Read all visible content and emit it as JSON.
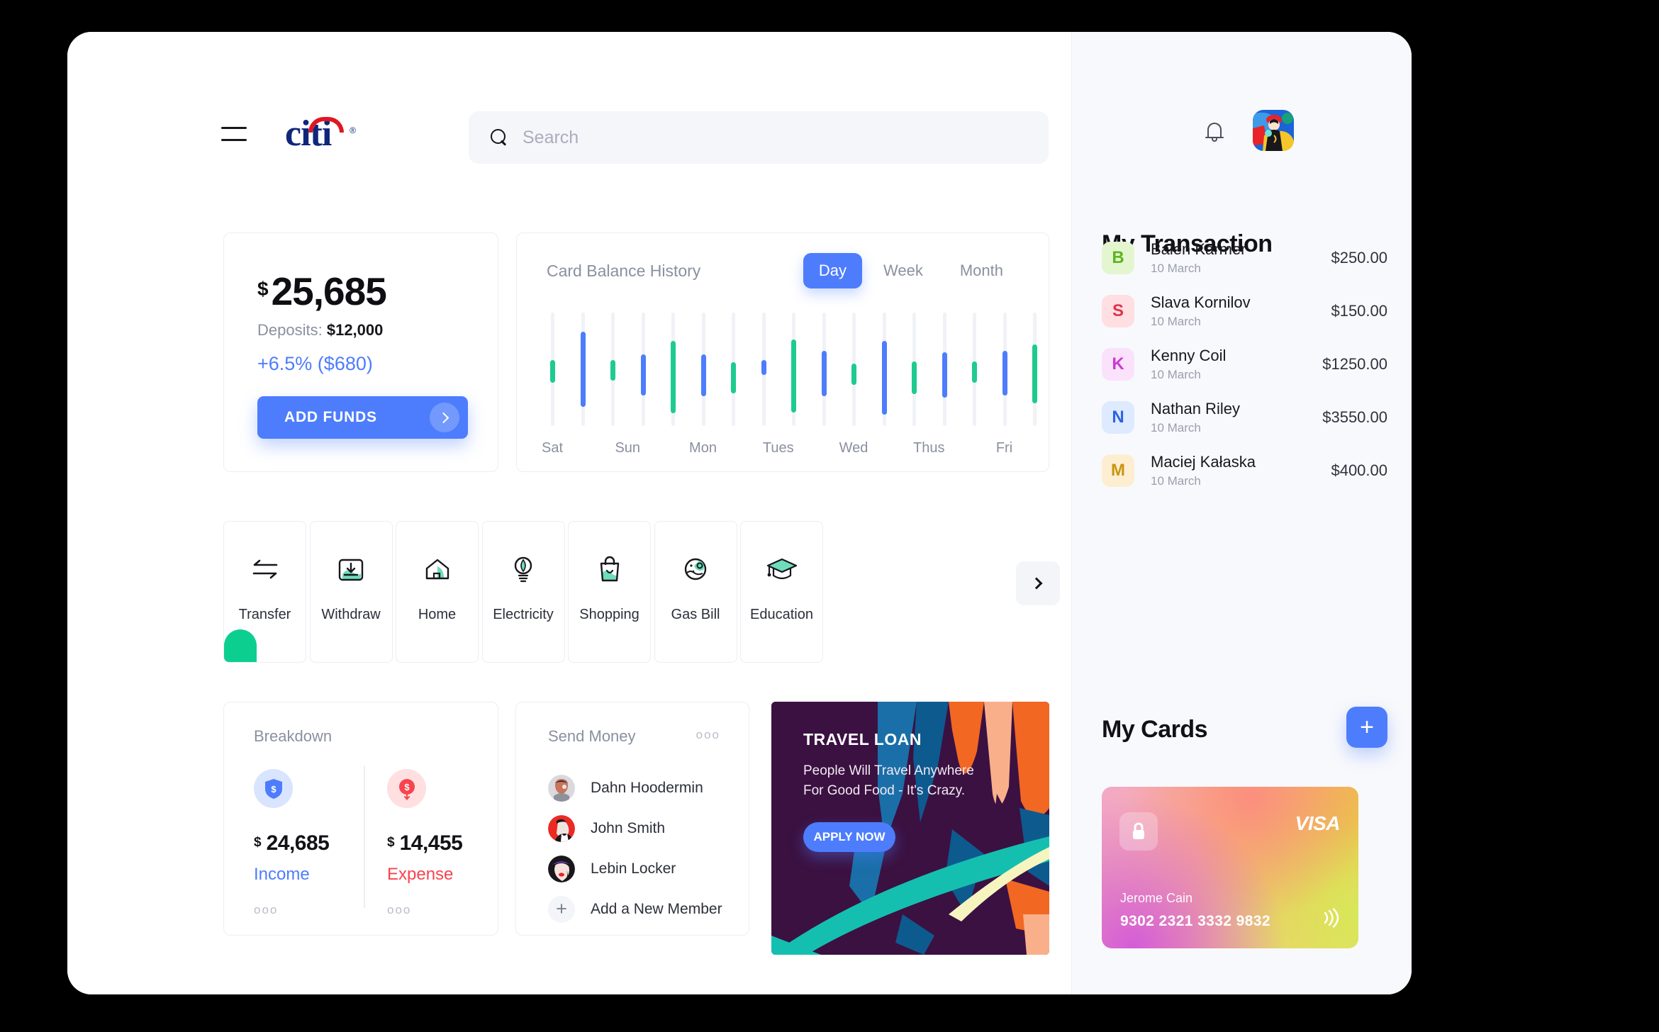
{
  "header": {
    "logo_text": "citi",
    "menu_icon": "hamburger-icon",
    "search_placeholder": "Search",
    "search_value": "",
    "bell_icon": "notification-bell-icon"
  },
  "balance": {
    "currency": "$",
    "amount": "25,685",
    "deposits_label": "Deposits:",
    "deposits_value": "$12,000",
    "change": "+6.5% ($680)",
    "cta": "ADD FUNDS"
  },
  "chart_card": {
    "title": "Card Balance History",
    "ranges": [
      {
        "label": "Day",
        "active": true
      },
      {
        "label": "Week",
        "active": false
      },
      {
        "label": "Month",
        "active": false
      }
    ]
  },
  "chart_data": {
    "type": "bar",
    "title": "Card Balance History",
    "subtitle": "Day",
    "xlabel": "",
    "ylabel": "",
    "grid": false,
    "legend": false,
    "axis_range": [
      0,
      100
    ],
    "categories": [
      "Sat",
      "Sun",
      "Mon",
      "Tues",
      "Wed",
      "Thus",
      "Fri"
    ],
    "note": "Floating range bars: each bar has a low and high value on a 0-100 track; color encodes direction.",
    "bars": [
      {
        "index": 0,
        "low": 38,
        "high": 58,
        "color": "green"
      },
      {
        "index": 1,
        "low": 17,
        "high": 83,
        "color": "blue"
      },
      {
        "index": 2,
        "low": 40,
        "high": 58,
        "color": "green"
      },
      {
        "index": 3,
        "low": 27,
        "high": 63,
        "color": "blue"
      },
      {
        "index": 4,
        "low": 11,
        "high": 75,
        "color": "green"
      },
      {
        "index": 5,
        "low": 26,
        "high": 63,
        "color": "blue"
      },
      {
        "index": 6,
        "low": 29,
        "high": 56,
        "color": "green"
      },
      {
        "index": 7,
        "low": 45,
        "high": 58,
        "color": "blue"
      },
      {
        "index": 8,
        "low": 12,
        "high": 76,
        "color": "green"
      },
      {
        "index": 9,
        "low": 26,
        "high": 66,
        "color": "blue"
      },
      {
        "index": 10,
        "low": 36,
        "high": 55,
        "color": "green"
      },
      {
        "index": 11,
        "low": 10,
        "high": 75,
        "color": "blue"
      },
      {
        "index": 12,
        "low": 28,
        "high": 57,
        "color": "green"
      },
      {
        "index": 13,
        "low": 25,
        "high": 65,
        "color": "blue"
      },
      {
        "index": 14,
        "low": 38,
        "high": 57,
        "color": "green"
      },
      {
        "index": 15,
        "low": 27,
        "high": 66,
        "color": "blue"
      },
      {
        "index": 16,
        "low": 20,
        "high": 72,
        "color": "green"
      }
    ],
    "colors": {
      "green": "#1ecb8f",
      "blue": "#4d7dfd",
      "track": "#f1f2f7"
    }
  },
  "quick_actions": [
    {
      "label": "Transfer",
      "icon": "transfer-arrows-icon"
    },
    {
      "label": "Withdraw",
      "icon": "withdraw-download-icon"
    },
    {
      "label": "Home",
      "icon": "home-icon"
    },
    {
      "label": "Electricity",
      "icon": "lightbulb-icon"
    },
    {
      "label": "Shopping",
      "icon": "shopping-bag-icon"
    },
    {
      "label": "Gas Bill",
      "icon": "fuel-drop-icon"
    },
    {
      "label": "Education",
      "icon": "graduation-cap-icon"
    }
  ],
  "quick_actions_next": "next-arrow-icon",
  "breakdown": {
    "title": "Breakdown",
    "items": [
      {
        "icon": "shield-dollar-icon",
        "currency": "$",
        "value": "24,685",
        "label": "Income",
        "color": "#4d7dfd",
        "bg": "#d9e5ff"
      },
      {
        "icon": "expense-dollar-icon",
        "currency": "$",
        "value": "14,455",
        "label": "Expense",
        "color": "#f7444e",
        "bg": "#ffdfe0"
      }
    ],
    "more": "ooo"
  },
  "send_money": {
    "title": "Send Money",
    "more": "ooo",
    "members": [
      {
        "name": "Dahn Hoodermin",
        "avatar": "avatar-dahn"
      },
      {
        "name": "John Smith",
        "avatar": "avatar-john"
      },
      {
        "name": "Lebin Locker",
        "avatar": "avatar-lebin"
      }
    ],
    "add_label": "Add a New Member"
  },
  "promo": {
    "title": "TRAVEL LOAN",
    "subtitle": "People Will Travel Anywhere\nFor Good Food - It's Crazy.",
    "cta": "APPLY NOW"
  },
  "transactions": {
    "title": "My Transaction",
    "items": [
      {
        "initial": "B",
        "name": "Balen Karmer",
        "date": "10 March",
        "amount": "$250.00",
        "bg": "#e4f6cf",
        "fg": "#5cb522"
      },
      {
        "initial": "S",
        "name": "Slava Kornilov",
        "date": "10 March",
        "amount": "$150.00",
        "bg": "#ffdfe1",
        "fg": "#e0334a"
      },
      {
        "initial": "K",
        "name": "Kenny Coil",
        "date": "10 March",
        "amount": "$1250.00",
        "bg": "#fbe2fb",
        "fg": "#cc3ad0"
      },
      {
        "initial": "N",
        "name": "Nathan Riley",
        "date": "10 March",
        "amount": "$3550.00",
        "bg": "#ddeaff",
        "fg": "#2b63e0"
      },
      {
        "initial": "M",
        "name": "Maciej Kałaska",
        "date": "10 March",
        "amount": "$400.00",
        "bg": "#fdeed2",
        "fg": "#c99512"
      }
    ]
  },
  "cards_section": {
    "title": "My Cards",
    "add_label": "+",
    "card": {
      "holder": "Jerome Cain",
      "number": "9302 2321 3332 9832",
      "brand": "VISA",
      "lock_icon": "lock-icon",
      "contactless_icon": "contactless-icon"
    }
  }
}
